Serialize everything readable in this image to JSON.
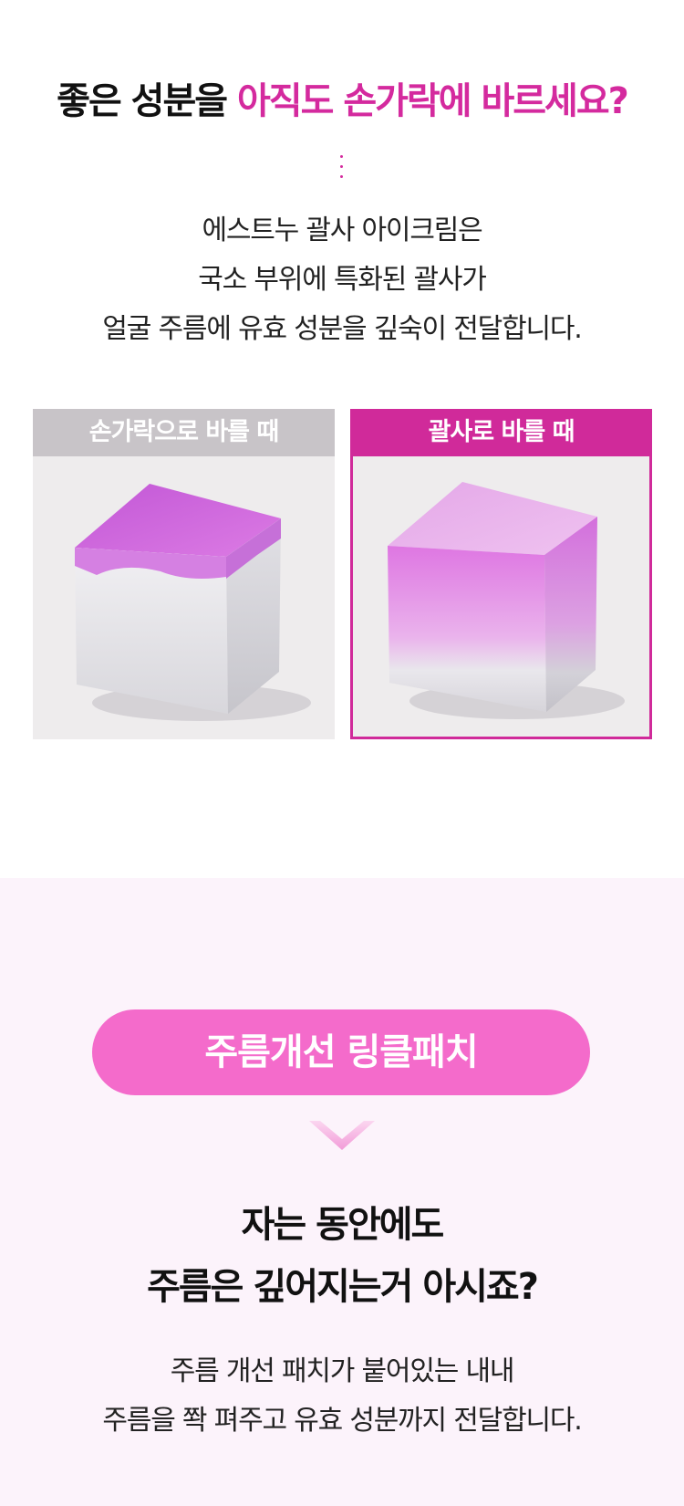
{
  "headline": {
    "part1": "좋은 성분을 ",
    "part2": "아직도 손가락에 바르세요?"
  },
  "intro": {
    "line1": "에스트누 괄사 아이크림은",
    "line2": "국소 부위에 특화된 괄사가",
    "line3": "얼굴 주름에 유효 성분을 깊숙이 전달합니다."
  },
  "compare": {
    "finger_label": "손가락으로 바를 때",
    "guasha_label": "괄사로 바를 때",
    "finger_absorption": 0.25,
    "guasha_absorption": 0.6
  },
  "patch": {
    "pill_label": "주름개선 링클패치",
    "heading_line1": "자는 동안에도",
    "heading_line2": "주름은 깊어지는거 아시죠?",
    "body_line1": "주름 개선 패치가 붙어있는 내내",
    "body_line2": "주름을 쫙 펴주고 유효 성분까지 전달합니다."
  },
  "colors": {
    "accent": "#d42a9e",
    "pill": "#f46bcb",
    "section_bg": "#fcf3fb",
    "label_gray": "#c8c4c8"
  },
  "icons": {
    "divider": "dotted-divider-icon",
    "arrow": "chevron-down-icon"
  }
}
